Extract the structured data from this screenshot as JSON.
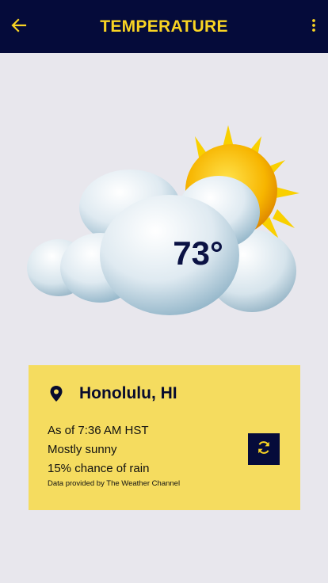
{
  "header": {
    "title": "TEMPERATURE",
    "back_icon": "arrow-left-icon",
    "menu_icon": "more-vert-icon"
  },
  "weather": {
    "temperature": "73°",
    "condition_icon": "partly-cloudy-icon"
  },
  "card": {
    "location_icon": "location-pin-icon",
    "location": "Honolulu, HI",
    "as_of": "As of 7:36 AM HST",
    "condition": "Mostly sunny",
    "rain_chance": "15% chance of rain",
    "attribution": "Data provided by The Weather Channel",
    "refresh_icon": "refresh-icon"
  },
  "colors": {
    "header_bg": "#050b3a",
    "accent_yellow": "#f9d423",
    "card_bg": "#f5dc5f",
    "page_bg": "#e8e7ed"
  }
}
